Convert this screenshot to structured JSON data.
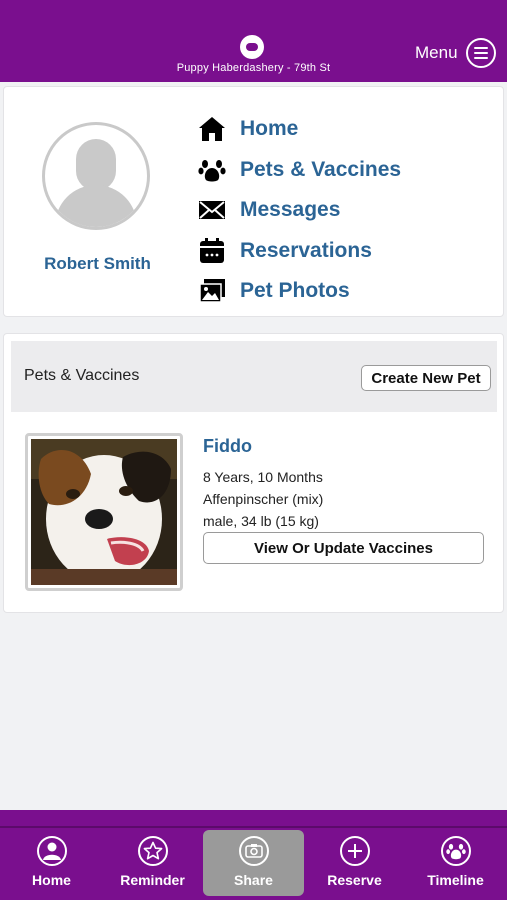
{
  "header": {
    "location": "Puppy Haberdashery - 79th St",
    "menu_label": "Menu"
  },
  "profile": {
    "user_name": "Robert Smith",
    "nav": [
      {
        "label": "Home",
        "icon": "home-icon"
      },
      {
        "label": "Pets & Vaccines",
        "icon": "paw-icon"
      },
      {
        "label": "Messages",
        "icon": "envelope-icon"
      },
      {
        "label": "Reservations",
        "icon": "calendar-icon"
      },
      {
        "label": "Pet Photos",
        "icon": "photos-icon"
      }
    ]
  },
  "pets": {
    "title": "Pets & Vaccines",
    "create_button": "Create New Pet",
    "pet": {
      "name": "Fiddo",
      "age": "8 Years, 10 Months",
      "breed": "Affenpinscher (mix)",
      "details": "male, 34 lb (15 kg)",
      "vaccines_button": "View Or Update Vaccines"
    }
  },
  "bottom_nav": [
    {
      "label": "Home",
      "icon": "user-icon"
    },
    {
      "label": "Reminder",
      "icon": "star-icon"
    },
    {
      "label": "Share",
      "icon": "camera-icon",
      "active": true
    },
    {
      "label": "Reserve",
      "icon": "plus-icon"
    },
    {
      "label": "Timeline",
      "icon": "paw-icon"
    }
  ],
  "colors": {
    "brand": "#7a0f8e",
    "link": "#2b6495",
    "active_tab": "#9a9a9a"
  }
}
